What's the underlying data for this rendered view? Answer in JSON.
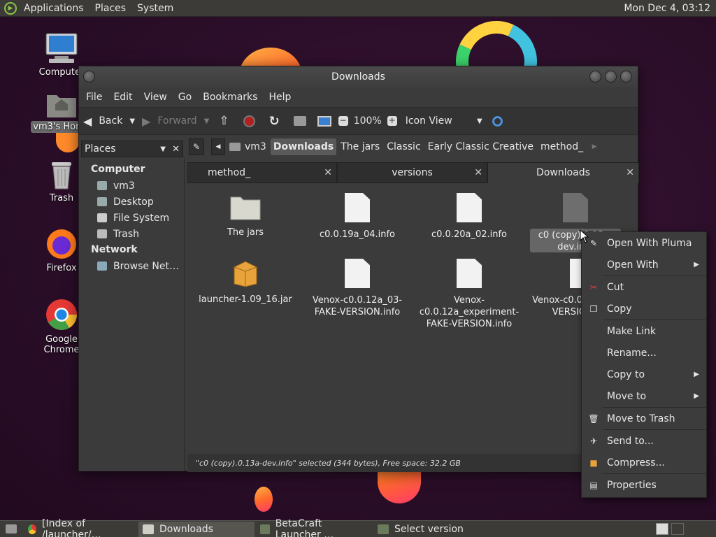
{
  "top_panel": {
    "applications": "Applications",
    "places": "Places",
    "system": "System",
    "clock": "Mon Dec  4, 03:12"
  },
  "desktop_icons": {
    "computer": "Computer",
    "home": "vm3's Home",
    "trash": "Trash",
    "firefox": "Firefox",
    "chrome": "Google Chrome"
  },
  "window": {
    "title": "Downloads",
    "menu": [
      "File",
      "Edit",
      "View",
      "Go",
      "Bookmarks",
      "Help"
    ],
    "toolbar": {
      "back": "Back",
      "forward": "Forward",
      "zoom": "100%",
      "view_mode": "Icon View"
    },
    "sidebar": {
      "header": "Places",
      "sections": [
        {
          "title": "Computer",
          "items": [
            "vm3",
            "Desktop",
            "File System",
            "Trash"
          ]
        },
        {
          "title": "Network",
          "items": [
            "Browse Net…"
          ]
        }
      ]
    },
    "breadcrumbs": [
      "vm3",
      "Downloads",
      "The jars",
      "Classic",
      "Early Classic Creative",
      "method_"
    ],
    "tabs": [
      {
        "label": "method_",
        "close": "✕"
      },
      {
        "label": "versions",
        "close": "✕"
      },
      {
        "label": "Downloads",
        "close": "✕"
      }
    ],
    "files": [
      {
        "name": "The jars",
        "type": "folder"
      },
      {
        "name": "c0.0.19a_04.info",
        "type": "doc"
      },
      {
        "name": "c0.0.20a_02.info",
        "type": "doc"
      },
      {
        "name": "c0 (copy).0.13a-dev.info",
        "type": "doc-selected"
      },
      {
        "name": "launcher-1.09_16.jar",
        "type": "jar"
      },
      {
        "name": "Venox-c0.0.12a_03-FAKE-VERSION.info",
        "type": "doc"
      },
      {
        "name": "Venox-c0.0.12a_experiment-FAKE-VERSION.info",
        "type": "doc"
      },
      {
        "name": "Venox-c0.0.12a_FAKE-VERSION.info",
        "type": "doc"
      }
    ],
    "status": "\"c0 (copy).0.13a-dev.info\" selected (344 bytes), Free space: 32.2 GB"
  },
  "context_menu": [
    {
      "label": "Open With Pluma",
      "icon": "pluma-icon"
    },
    {
      "label": "Open With",
      "submenu": true
    },
    {
      "label": "Cut",
      "icon": "scissors-icon"
    },
    {
      "label": "Copy",
      "icon": "copy-icon"
    },
    {
      "label": "Make Link"
    },
    {
      "label": "Rename..."
    },
    {
      "label": "Copy to",
      "submenu": true
    },
    {
      "label": "Move to",
      "submenu": true
    },
    {
      "label": "Move to Trash",
      "icon": "trash-icon"
    },
    {
      "label": "Send to...",
      "icon": "send-icon"
    },
    {
      "label": "Compress...",
      "icon": "archive-icon"
    },
    {
      "label": "Properties",
      "icon": "properties-icon"
    }
  ],
  "taskbar": [
    {
      "label": "[Index of /launcher/…",
      "icon": "chrome-icon"
    },
    {
      "label": "Downloads",
      "icon": "folder-icon",
      "active": true
    },
    {
      "label": "BetaCraft Launcher …",
      "icon": "java-icon"
    },
    {
      "label": "Select version",
      "icon": "java-icon"
    }
  ]
}
